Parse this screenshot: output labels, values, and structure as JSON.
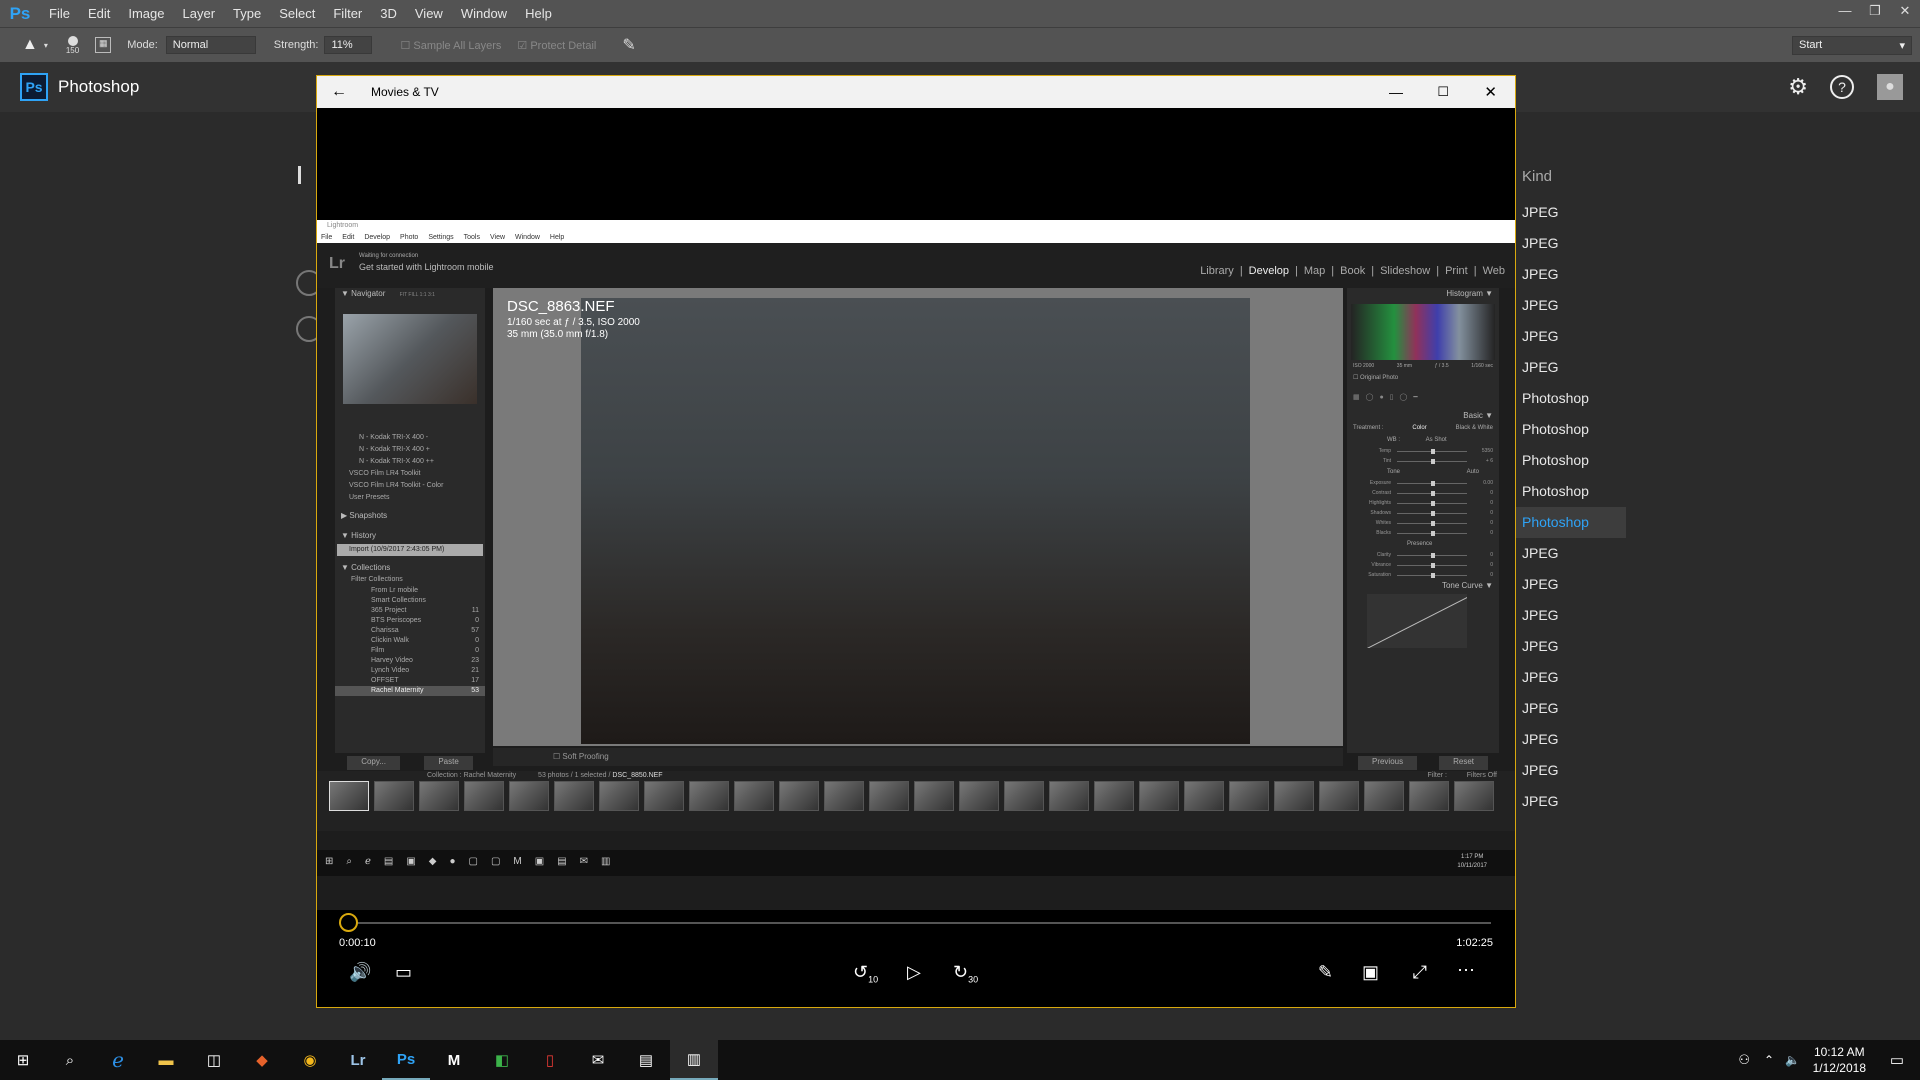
{
  "ps": {
    "logo": "Ps",
    "menus": [
      "File",
      "Edit",
      "Image",
      "Layer",
      "Type",
      "Select",
      "Filter",
      "3D",
      "View",
      "Window",
      "Help"
    ],
    "options": {
      "brush_size": "150",
      "mode_label": "Mode:",
      "mode_value": "Normal",
      "strength_label": "Strength:",
      "strength_value": "11%",
      "sample_all_layers": "Sample All Layers",
      "protect_detail": "Protect Detail",
      "workspace": "Start"
    },
    "home_title": "Photoshop",
    "kind_header": "Kind",
    "kinds": [
      "JPEG",
      "JPEG",
      "JPEG",
      "JPEG",
      "JPEG",
      "JPEG",
      "Photoshop",
      "Photoshop",
      "Photoshop",
      "Photoshop",
      "Photoshop",
      "JPEG",
      "JPEG",
      "JPEG",
      "JPEG",
      "JPEG",
      "JPEG",
      "JPEG",
      "JPEG",
      "JPEG"
    ],
    "highlight_index": 10
  },
  "movies": {
    "title": "Movies & TV",
    "current_time": "0:00:10",
    "total_time": "1:02:25",
    "skip_back": "10",
    "skip_forward": "30"
  },
  "lightroom": {
    "app_title": "Lightroom",
    "menus": [
      "File",
      "Edit",
      "Develop",
      "Photo",
      "Settings",
      "Tools",
      "View",
      "Window",
      "Help"
    ],
    "connection": "Waiting for connection",
    "get_started": "Get started with Lightroom mobile",
    "modules": [
      "Library",
      "Develop",
      "Map",
      "Book",
      "Slideshow",
      "Print",
      "Web"
    ],
    "active_module": "Develop",
    "navigator": "Navigator",
    "nav_zoom": "FIT FILL 1:1 3:1",
    "presets": [
      "N - Kodak TRI-X 400 -",
      "N - Kodak TRI-X 400 +",
      "N - Kodak TRI-X 400 ++",
      "VSCO Film LR4 Toolkit",
      "VSCO Film LR4 Toolkit - Color",
      "User Presets"
    ],
    "snapshots": "Snapshots",
    "history": "History",
    "history_item": "Import (10/9/2017 2:43:05 PM)",
    "collections": "Collections",
    "filter_collections": "Filter Collections",
    "collection_items": [
      {
        "name": "From Lr mobile",
        "count": ""
      },
      {
        "name": "Smart Collections",
        "count": ""
      },
      {
        "name": "365 Project",
        "count": "11"
      },
      {
        "name": "BTS Periscopes",
        "count": "0"
      },
      {
        "name": "Charissa",
        "count": "57"
      },
      {
        "name": "Clickin Walk",
        "count": "0"
      },
      {
        "name": "Film",
        "count": "0"
      },
      {
        "name": "Harvey Video",
        "count": "23"
      },
      {
        "name": "Lynch Video",
        "count": "21"
      },
      {
        "name": "OFFSET",
        "count": "17"
      },
      {
        "name": "Rachel Maternity",
        "count": "53"
      }
    ],
    "copy": "Copy...",
    "paste": "Paste",
    "soft_proofing": "Soft Proofing",
    "photo_name": "DSC_8863.NEF",
    "photo_exposure": "1/160 sec at ƒ / 3.5, ISO 2000",
    "photo_lens": "35 mm (35.0 mm f/1.8)",
    "histogram": "Histogram",
    "hist_info": [
      "ISO 2000",
      "35 mm",
      "ƒ / 3.5",
      "1/160 sec"
    ],
    "original_photo": "Original Photo",
    "basic": "Basic",
    "treatment": "Treatment :",
    "color": "Color",
    "bw": "Black & White",
    "wb": "WB :",
    "wb_value": "As Shot",
    "sliders_wb": [
      {
        "name": "Temp",
        "value": "5350"
      },
      {
        "name": "Tint",
        "value": "+ 6"
      }
    ],
    "tone": "Tone",
    "auto": "Auto",
    "sliders_tone": [
      {
        "name": "Exposure",
        "value": "0.00"
      },
      {
        "name": "Contrast",
        "value": "0"
      },
      {
        "name": "Highlights",
        "value": "0"
      },
      {
        "name": "Shadows",
        "value": "0"
      },
      {
        "name": "Whites",
        "value": "0"
      },
      {
        "name": "Blacks",
        "value": "0"
      }
    ],
    "presence": "Presence",
    "sliders_presence": [
      {
        "name": "Clarity",
        "value": "0"
      },
      {
        "name": "Vibrance",
        "value": "0"
      },
      {
        "name": "Saturation",
        "value": "0"
      }
    ],
    "tone_curve": "Tone Curve",
    "previous": "Previous",
    "reset": "Reset",
    "film_collection": "Collection : Rachel Maternity",
    "film_count": "53 photos / 1 selected /",
    "film_file": "DSC_8850.NEF",
    "filter": "Filter :",
    "filter_value": "Filters Off",
    "inner_clock_time": "1:17 PM",
    "inner_clock_date": "10/11/2017"
  },
  "taskbar": {
    "time": "10:12 AM",
    "date": "1/12/2018",
    "apps": [
      "Edge",
      "File Explorer",
      "Store",
      "Sketchbook",
      "Chrome",
      "Lightroom",
      "Photoshop",
      "Mendeley",
      "Camtasia",
      "Acrobat",
      "Mail",
      "Calculator",
      "Movies & TV"
    ]
  }
}
